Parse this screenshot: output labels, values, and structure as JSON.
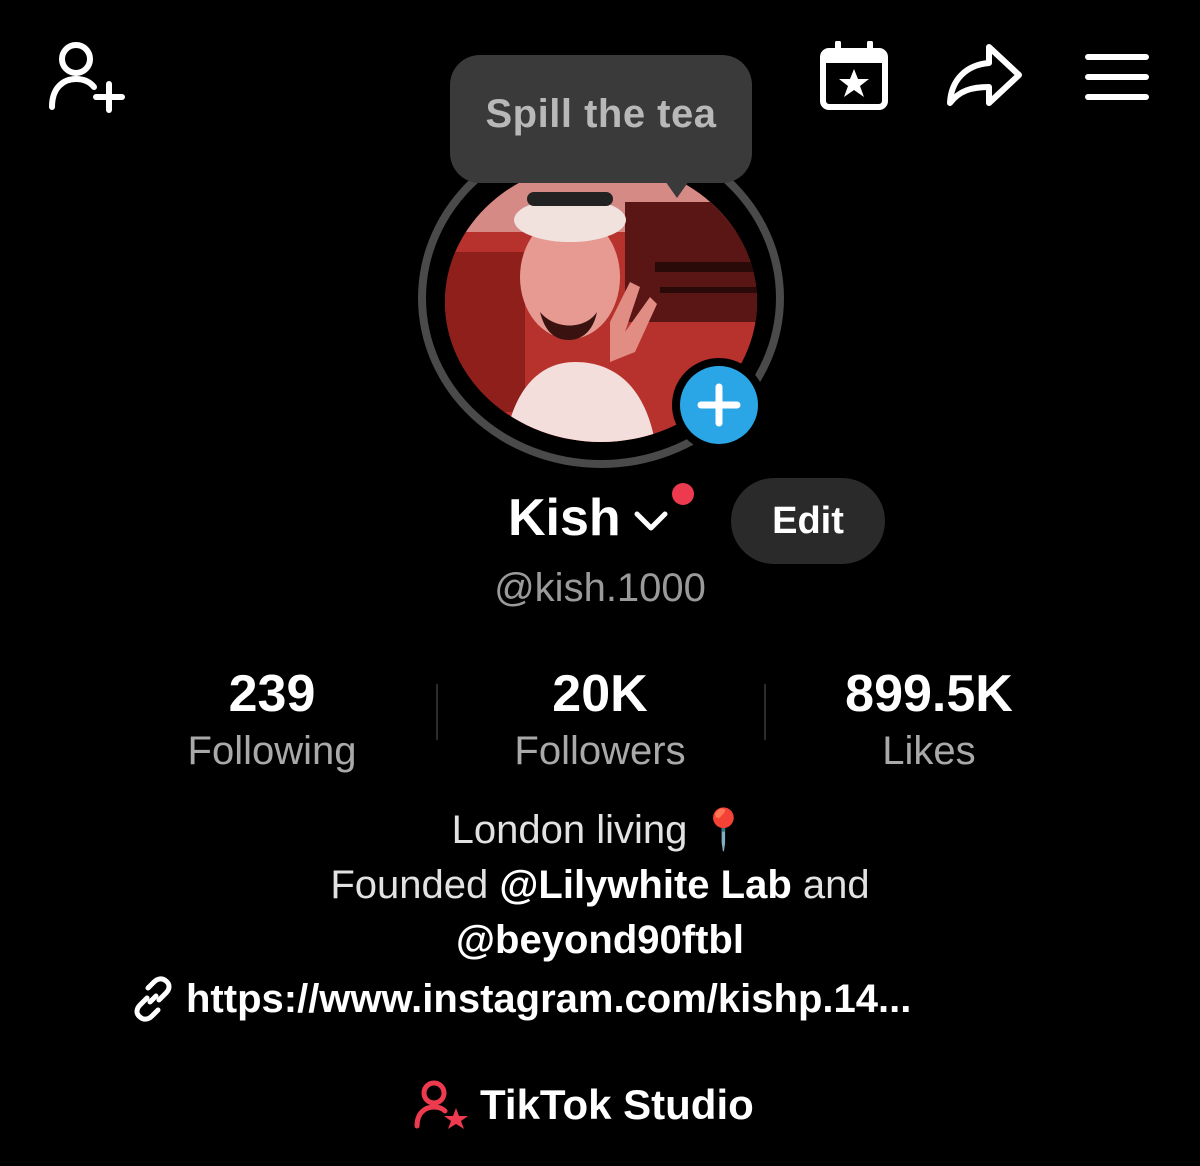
{
  "top_bar": {
    "add_friend_icon": "person-plus-icon",
    "events_icon": "calendar-star-icon",
    "share_icon": "share-arrow-icon",
    "menu_icon": "hamburger-menu-icon"
  },
  "tooltip": {
    "text": "Spill the tea"
  },
  "profile": {
    "display_name": "Kish",
    "username": "@kish.1000",
    "edit_label": "Edit",
    "accent_color": "#ee3a4f",
    "add_story_color": "#2aa6e6"
  },
  "stats": [
    {
      "value": "239",
      "label": "Following"
    },
    {
      "value": "20K",
      "label": "Followers"
    },
    {
      "value": "899.5K",
      "label": "Likes"
    }
  ],
  "bio": {
    "line1": "London living",
    "line1_emoji": "📍",
    "line2_prefix": "Founded ",
    "mention1": "@Lilywhite Lab",
    "line2_suffix": " and",
    "mention2": "@beyond90ftbl"
  },
  "link": {
    "icon": "link-icon",
    "text": "https://www.instagram.com/kishp.14..."
  },
  "studio": {
    "icon": "person-star-icon",
    "label": "TikTok Studio"
  }
}
